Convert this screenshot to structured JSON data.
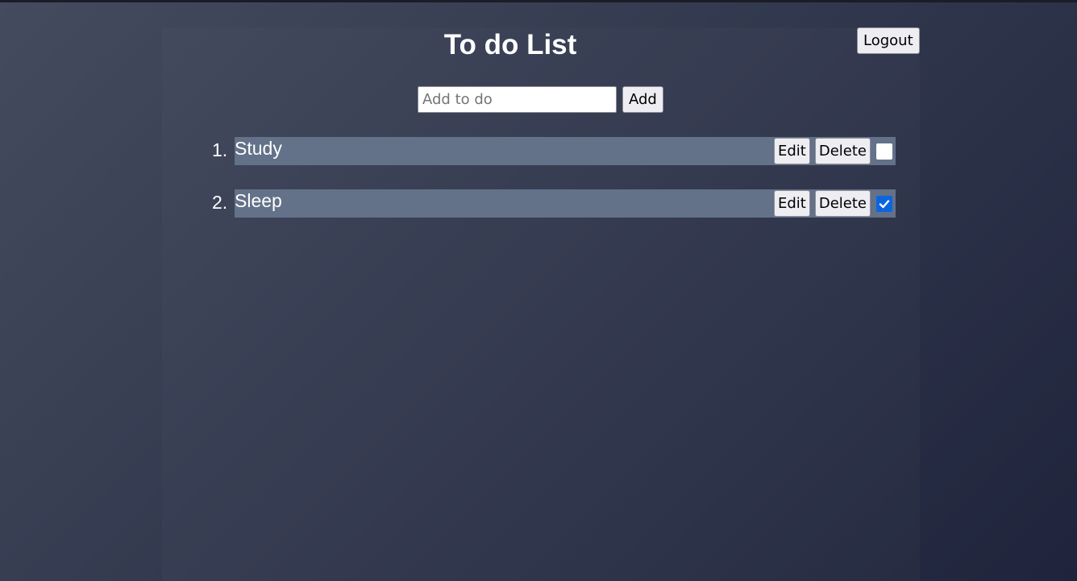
{
  "header": {
    "title": "To do List",
    "logout_label": "Logout"
  },
  "add": {
    "placeholder": "Add to do",
    "value": "",
    "button_label": "Add"
  },
  "todos": [
    {
      "number": "1.",
      "text": "Study",
      "edit_label": "Edit",
      "delete_label": "Delete",
      "done": false
    },
    {
      "number": "2.",
      "text": "Sleep",
      "edit_label": "Edit",
      "delete_label": "Delete",
      "done": true
    }
  ],
  "colors": {
    "item_background": "#637189",
    "checkbox_checked": "#0a66dd",
    "button_background": "#eeeef2"
  }
}
